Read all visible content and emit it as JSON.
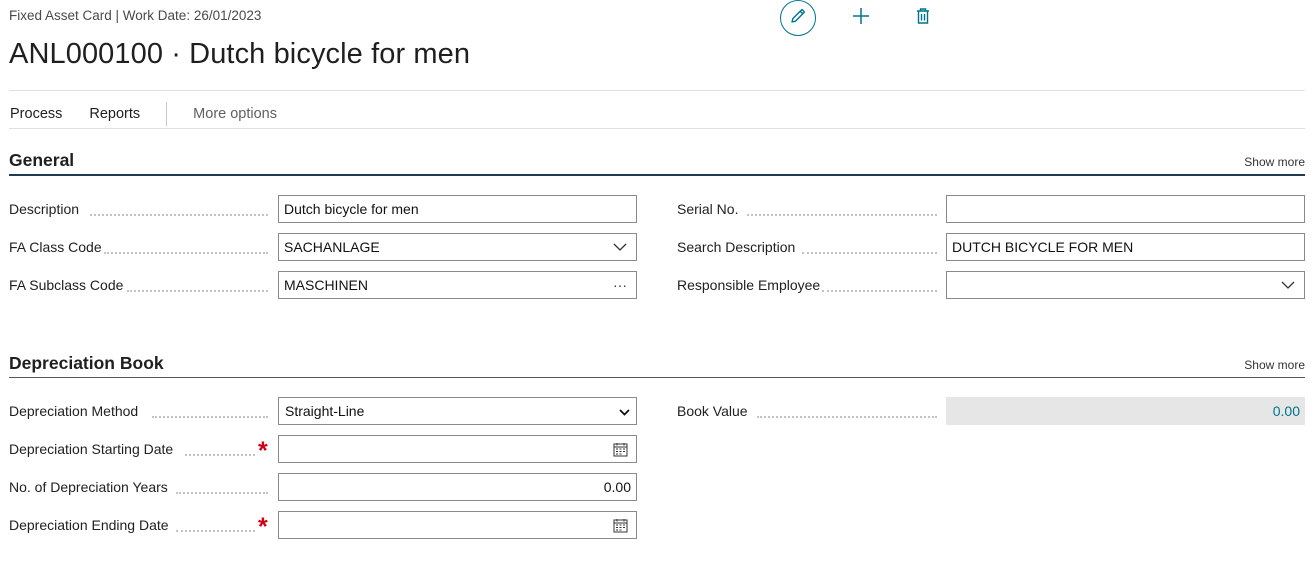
{
  "header": {
    "breadcrumb": "Fixed Asset Card | Work Date: 26/01/2023",
    "title": "ANL000100 · Dutch bicycle for men",
    "actions": {
      "edit_icon": "pencil-icon",
      "new_icon": "plus-icon",
      "delete_icon": "trash-icon"
    }
  },
  "menu": {
    "process": "Process",
    "reports": "Reports",
    "more": "More options"
  },
  "general": {
    "title": "General",
    "show_more": "Show more",
    "description": {
      "label": "Description",
      "value": "Dutch bicycle for men"
    },
    "fa_class_code": {
      "label": "FA Class Code",
      "value": "SACHANLAGE"
    },
    "fa_subclass_code": {
      "label": "FA Subclass Code",
      "value": "MASCHINEN",
      "lookup": "···"
    },
    "serial_no": {
      "label": "Serial No.",
      "value": ""
    },
    "search_description": {
      "label": "Search Description",
      "value": "DUTCH BICYCLE FOR MEN"
    },
    "responsible_employee": {
      "label": "Responsible Employee",
      "value": ""
    }
  },
  "depreciation_book": {
    "title": "Depreciation Book",
    "show_more": "Show more",
    "method": {
      "label": "Depreciation Method",
      "value": "Straight-Line"
    },
    "starting_date": {
      "label": "Depreciation Starting Date",
      "value": "",
      "required_mark": "*"
    },
    "no_of_years": {
      "label": "No. of Depreciation Years",
      "value": "0.00"
    },
    "ending_date": {
      "label": "Depreciation Ending Date",
      "value": "",
      "required_mark": "*"
    },
    "book_value": {
      "label": "Book Value",
      "value": "0.00"
    }
  },
  "colors": {
    "accent": "#00738f",
    "required": "#d0021b",
    "section_line": "#1f3a52"
  }
}
